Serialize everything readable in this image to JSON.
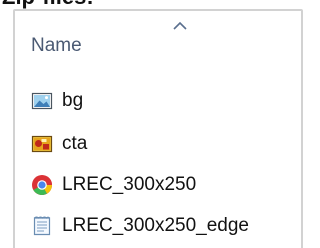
{
  "window": {
    "title": "Zip-files:"
  },
  "header": {
    "column_name": "Name",
    "sort_indicator": "ascending"
  },
  "files": [
    {
      "name": "bg",
      "icon": "image-file-icon"
    },
    {
      "name": "cta",
      "icon": "image-file-icon"
    },
    {
      "name": "LREC_300x250",
      "icon": "chrome-html-icon"
    },
    {
      "name": "LREC_300x250_edge",
      "icon": "text-file-icon"
    }
  ]
}
